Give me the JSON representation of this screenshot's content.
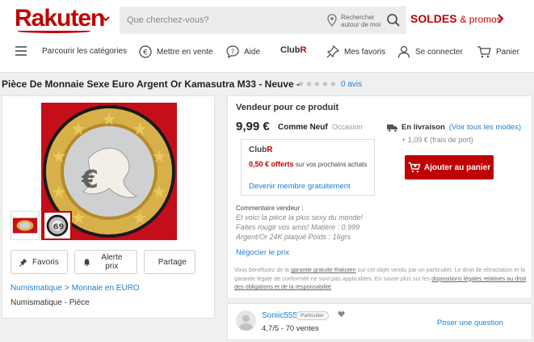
{
  "header": {
    "logo": "Rakuten",
    "search_placeholder": "Que cherchez-vous?",
    "near_me": "Rechercher autour de moi",
    "soldes": "SOLDES",
    "promos": "& promos",
    "nav": {
      "categories": "Parcourir les catégories",
      "sell": "Mettre en vente",
      "help": "Aide",
      "club_prefix": "Club",
      "club_suffix": "R",
      "favorites": "Mes favoris",
      "login": "Se connecter",
      "cart": "Panier"
    }
  },
  "product": {
    "title": "Pièce De Monnaie Sexe Euro Argent Or Kamasutra M33 - Neuve -",
    "stars": "★★★★★",
    "reviews": "0 avis",
    "actions": {
      "favoris": "Favoris",
      "alert": "Alerte prix",
      "share": "Partage"
    },
    "breadcrumb": [
      "Numismatique",
      "Monnaie en EURO"
    ],
    "breadcrumb_sep": ">",
    "category": "Numismatique - Pièce"
  },
  "offer": {
    "seller_heading": "Vendeur pour ce produit",
    "price": "9,99 €",
    "condition": "Comme Neuf",
    "occasion": "Occasion",
    "club": {
      "prefix": "Club",
      "suffix": "R",
      "offer_amount": "0,50 € offerts",
      "offer_text": "sur vos prochains achats",
      "link": "Devenir membre gratuitement"
    },
    "delivery_label": "En livraison",
    "delivery_link": "(Voir tous les modes)",
    "fee": "+ 1,09 € (frais de port)",
    "add_to_cart": "Ajouter au panier",
    "comment_heading": "Commentaire vendeur :",
    "comment": "Et voici la pièce la plus sexy du monde! Faites rougir vos amis! Matière : 0.999 Argent/Or 24K plaqué Poids : 16grs",
    "negotiate": "Négocier le prix",
    "legal_1": "Vous bénéficiez de la ",
    "legal_link1": "garantie gratuite Rakuten",
    "legal_2": " sur cet objet vendu par un particulier. Le droit de rétractation et la garantie légale de conformité ne sont pas applicables. En savoir plus sur les ",
    "legal_link2": "dispositions légales relatives au droit des obligations et de la responsabilité",
    "legal_3": "."
  },
  "seller": {
    "name": "Soniic555",
    "badge": "Particulier",
    "rating": "4,7/5 - 70 ventes",
    "ask": "Poser une question"
  },
  "colors": {
    "brand": "#bf0000",
    "link": "#1f7ecf"
  }
}
